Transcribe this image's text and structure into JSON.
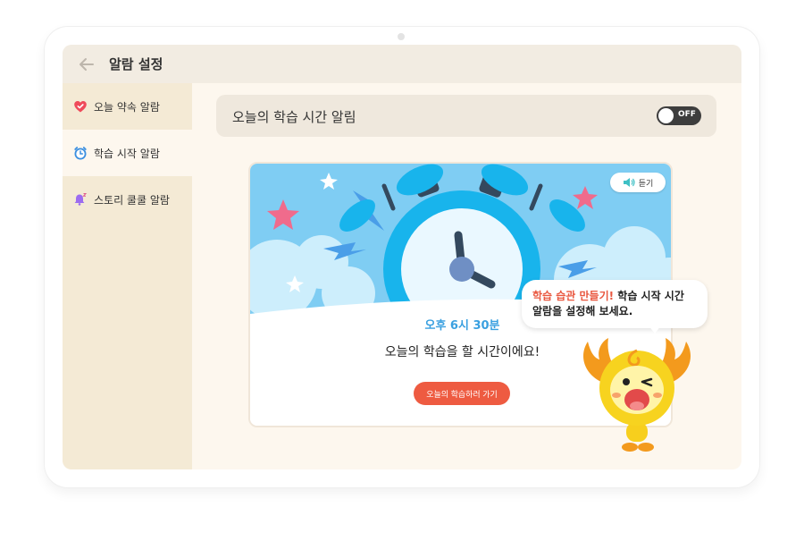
{
  "header": {
    "title": "알람 설정"
  },
  "sidebar": {
    "items": [
      {
        "label": "오늘 약속 알람",
        "active": false
      },
      {
        "label": "학습 시작 알람",
        "active": true
      },
      {
        "label": "스토리 쿨쿨 알람",
        "active": false
      }
    ]
  },
  "setting": {
    "label": "오늘의 학습 시간 알림",
    "toggle_state": "OFF"
  },
  "card": {
    "listen_label": "듣기",
    "time": "오후 6시 30분",
    "message": "오늘의 학습을 할 시간이에요!",
    "cta_label": "오늘의 학습하러 가기"
  },
  "bubble": {
    "highlight": "학습 습관 만들기!",
    "line1_rest": " 학습 시작 시간",
    "line2": "알람을 설정해 보세요."
  },
  "colors": {
    "accent": "#ee5b41",
    "time_blue": "#3aa0e0",
    "sidebar_bg": "#f4ead5",
    "toggle_off": "#3d3d3d"
  }
}
